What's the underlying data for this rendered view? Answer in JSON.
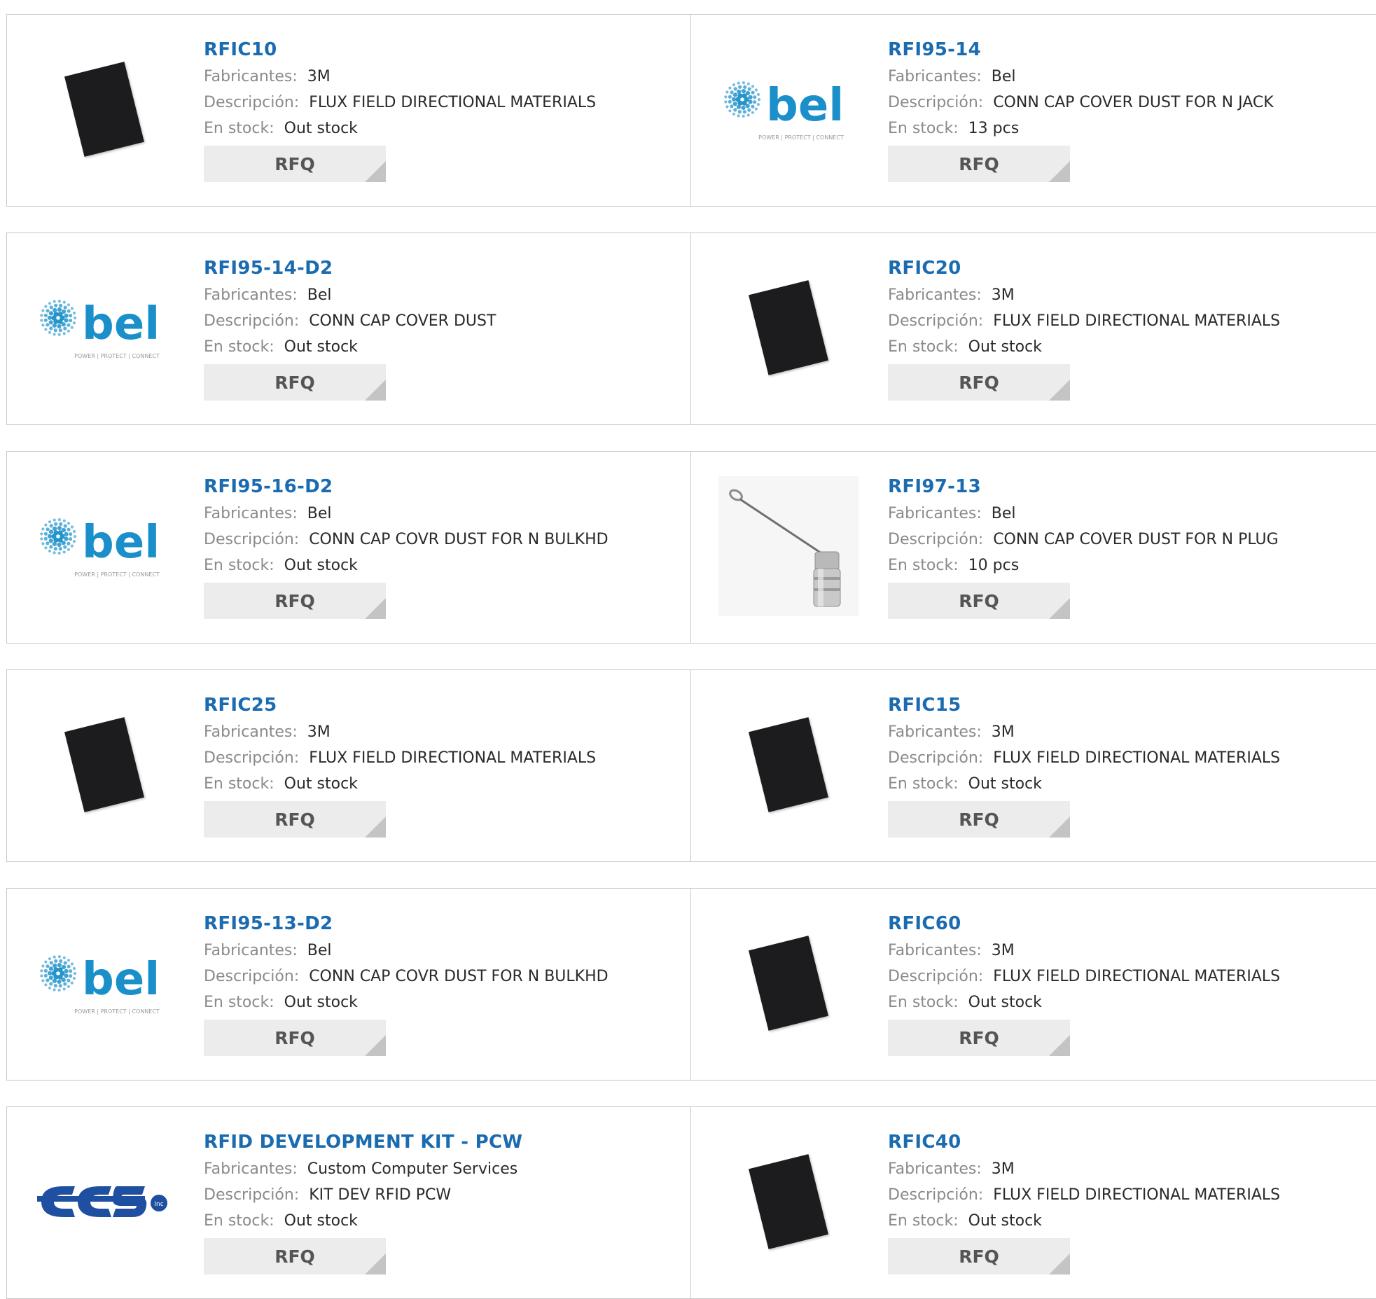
{
  "labels": {
    "manufacturer": "Fabricantes:",
    "description": "Descripción:",
    "stock": "En stock:",
    "rfq": "RFQ"
  },
  "bel_logo": {
    "brand": "bel",
    "tagline": "POWER | PROTECT | CONNECT",
    "color": "#1a8fc9"
  },
  "ccs_logo": {
    "brand": "CCS",
    "suffix": "Inc",
    "color": "#1f4fa0"
  },
  "colors": {
    "part_link": "#1a6bb0",
    "rfq_bg": "#ececec",
    "label": "#8a8a8a"
  },
  "products": [
    {
      "part": "RFIC10",
      "manufacturer": "3M",
      "description": "FLUX FIELD DIRECTIONAL MATERIALS",
      "stock": "Out stock",
      "image": "black-sheet"
    },
    {
      "part": "RFI95-14",
      "manufacturer": "Bel",
      "description": "CONN CAP COVER DUST FOR N JACK",
      "stock": "13 pcs",
      "image": "bel-logo"
    },
    {
      "part": "RFI95-14-D2",
      "manufacturer": "Bel",
      "description": "CONN CAP COVER DUST",
      "stock": "Out stock",
      "image": "bel-logo"
    },
    {
      "part": "RFIC20",
      "manufacturer": "3M",
      "description": "FLUX FIELD DIRECTIONAL MATERIALS",
      "stock": "Out stock",
      "image": "black-sheet"
    },
    {
      "part": "RFI95-16-D2",
      "manufacturer": "Bel",
      "description": "CONN CAP COVR DUST FOR N BULKHD",
      "stock": "Out stock",
      "image": "bel-logo"
    },
    {
      "part": "RFI97-13",
      "manufacturer": "Bel",
      "description": "CONN CAP COVER DUST FOR N PLUG",
      "stock": "10 pcs",
      "image": "cap-photo"
    },
    {
      "part": "RFIC25",
      "manufacturer": "3M",
      "description": "FLUX FIELD DIRECTIONAL MATERIALS",
      "stock": "Out stock",
      "image": "black-sheet"
    },
    {
      "part": "RFIC15",
      "manufacturer": "3M",
      "description": "FLUX FIELD DIRECTIONAL MATERIALS",
      "stock": "Out stock",
      "image": "black-sheet"
    },
    {
      "part": "RFI95-13-D2",
      "manufacturer": "Bel",
      "description": "CONN CAP COVR DUST FOR N BULKHD",
      "stock": "Out stock",
      "image": "bel-logo"
    },
    {
      "part": "RFIC60",
      "manufacturer": "3M",
      "description": "FLUX FIELD DIRECTIONAL MATERIALS",
      "stock": "Out stock",
      "image": "black-sheet"
    },
    {
      "part": "RFID DEVELOPMENT KIT - PCW",
      "manufacturer": "Custom Computer Services",
      "description": "KIT DEV RFID PCW",
      "stock": "Out stock",
      "image": "ccs-logo"
    },
    {
      "part": "RFIC40",
      "manufacturer": "3M",
      "description": "FLUX FIELD DIRECTIONAL MATERIALS",
      "stock": "Out stock",
      "image": "black-sheet"
    }
  ]
}
